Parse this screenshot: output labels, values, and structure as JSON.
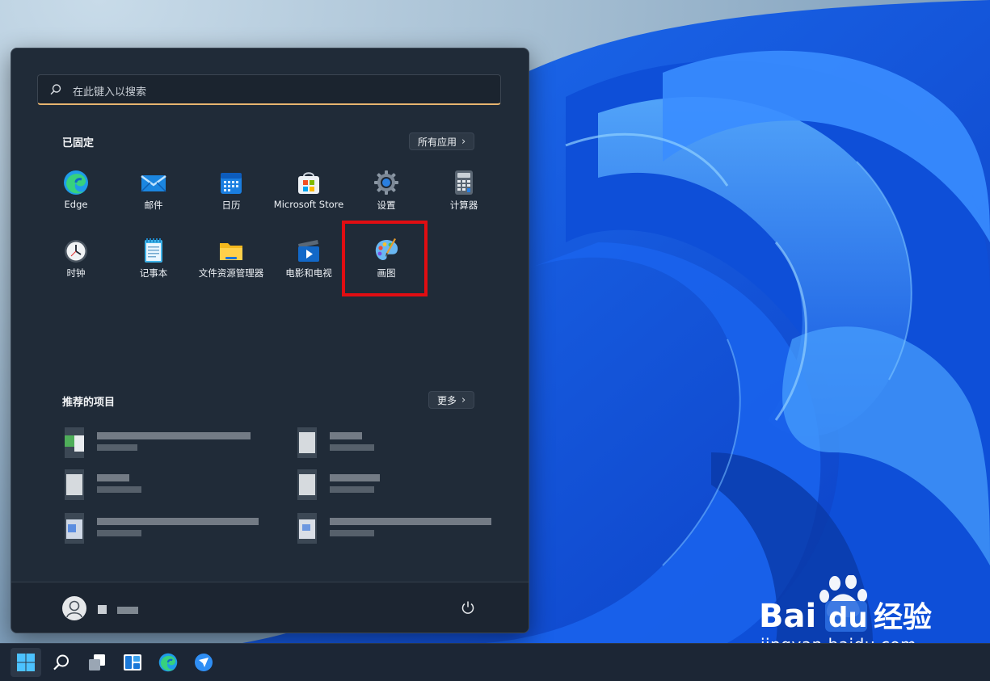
{
  "search": {
    "placeholder": "在此键入以搜索"
  },
  "pinned": {
    "title": "已固定",
    "all_apps_label": "所有应用",
    "apps": [
      {
        "label": "Edge",
        "icon": "edge-icon"
      },
      {
        "label": "邮件",
        "icon": "mail-icon"
      },
      {
        "label": "日历",
        "icon": "calendar-icon"
      },
      {
        "label": "Microsoft Store",
        "icon": "store-icon"
      },
      {
        "label": "设置",
        "icon": "settings-gear-icon"
      },
      {
        "label": "计算器",
        "icon": "calculator-icon"
      },
      {
        "label": "时钟",
        "icon": "clock-icon"
      },
      {
        "label": "记事本",
        "icon": "notepad-icon"
      },
      {
        "label": "文件资源管理器",
        "icon": "folder-icon"
      },
      {
        "label": "电影和电视",
        "icon": "movies-tv-icon"
      },
      {
        "label": "画图",
        "icon": "paint-palette-icon"
      }
    ]
  },
  "recommended": {
    "title": "推荐的项目",
    "more_label": "更多"
  },
  "taskbar": {
    "icons": [
      "windows-start-icon",
      "search-icon",
      "task-view-icon",
      "widgets-icon",
      "edge-icon",
      "feishu-icon"
    ]
  },
  "watermark": {
    "logo_text": "Baidu经验",
    "url": "jingyan.baidu.com"
  },
  "colors": {
    "start_bg": "#202b38",
    "accent_underline": "#e8b570",
    "highlight": "#e10d12"
  }
}
